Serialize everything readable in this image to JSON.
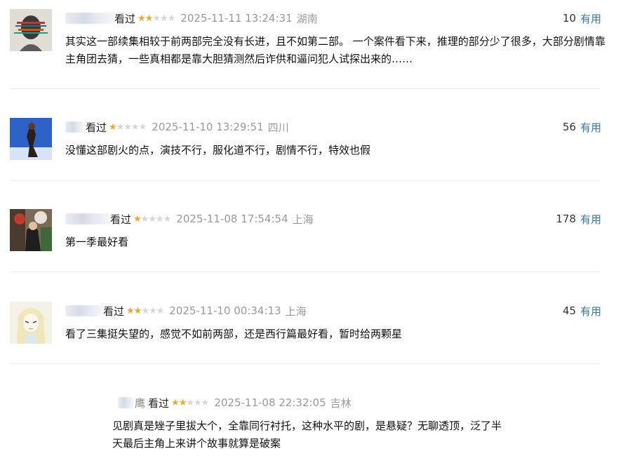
{
  "comments": [
    {
      "status": "看过",
      "rating": 2,
      "time": "2025-11-11 13:24:31",
      "location": "湖南",
      "useful_count": "10",
      "useful_label": "有用",
      "text": "其实这一部续集相较于前两部完全没有长进，且不如第二部。 一个案件看下来，推理的部分少了很多，大部分剧情靠主角团去猜，一些真相都是靠大胆猜测然后诈供和逼问犯人试探出来的……",
      "avatar": "glitch-face"
    },
    {
      "status": "看过",
      "rating": 1,
      "time": "2025-11-10 13:29:51",
      "location": "四川",
      "useful_count": "56",
      "useful_label": "有用",
      "text": "没懂这部剧火的点，演技不行，服化道不行，剧情不行，特效也假",
      "avatar": "person-sky"
    },
    {
      "status": "看过",
      "rating": 1,
      "time": "2025-11-08 17:54:54",
      "location": "上海",
      "useful_count": "178",
      "useful_label": "有用",
      "text": "第一季最好看",
      "avatar": "person-street"
    },
    {
      "status": "看过",
      "rating": 2,
      "time": "2025-11-10 00:34:13",
      "location": "上海",
      "useful_count": "45",
      "useful_label": "有用",
      "text": "看了三集挺失望的，感觉不如前两部，还是西行篇最好看，暂时给两颗星",
      "avatar": "anime-girl"
    },
    {
      "status": "看过",
      "rating": 2,
      "time": "2025-11-08 22:32:05",
      "location": "吉林",
      "text": "见剧真是矬子里拔大个，全靠同行衬托，这种水平的剧，是悬疑？无聊透顶，泛了半天最后主角上来讲个故事就算是破案",
      "name_suffix": "鹰"
    }
  ],
  "colors": {
    "star_on": "#f5a623",
    "star_off": "#d6d6d6",
    "meta_gray": "#999999",
    "link_blue": "#3377aa"
  }
}
